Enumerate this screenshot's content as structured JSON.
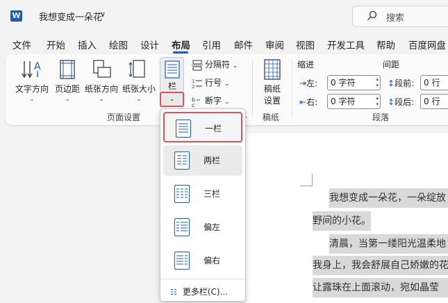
{
  "app": {
    "logo": "W",
    "doc_title": "我想变成一朵花",
    "title_chevron": "∨",
    "search_placeholder": "搜索"
  },
  "tabs": [
    "文件",
    "开始",
    "插入",
    "绘图",
    "设计",
    "布局",
    "引用",
    "邮件",
    "审阅",
    "视图",
    "开发工具",
    "帮助",
    "百度网盘"
  ],
  "active_tab": "布局",
  "ribbon": {
    "text_direction": "文字方向",
    "margins": "页边距",
    "orientation": "纸张方向",
    "size": "纸张大小",
    "columns": "栏",
    "breaks": "分隔符",
    "line_numbers": "行号",
    "hyphenation": "断字",
    "page_setup_group": "页面设置",
    "manuscript_line1": "稿纸",
    "manuscript_line2": "设置",
    "manuscript_group": "稿纸",
    "indent_title": "缩进",
    "spacing_title": "间距",
    "left_label": "左:",
    "right_label": "右:",
    "left_value": "0 字符",
    "right_value": "0 字符",
    "before_label": "段前:",
    "after_label": "段后:",
    "before_value": "0 行",
    "after_value": "0 行",
    "paragraph_group": "段落"
  },
  "dropdown": {
    "items": [
      "一栏",
      "两栏",
      "三栏",
      "偏左",
      "偏右"
    ],
    "more": "更多栏(C)..."
  },
  "document": {
    "lines": [
      "我想变成一朵花，一朵绽放",
      "野间的小花。",
      "清晨，当第一缕阳光温柔地",
      "我身上，我会舒展自己娇嫩的花",
      "让露珠在上面滚动，宛如晶莹"
    ]
  },
  "colors": {
    "accent": "#185abd",
    "highlight": "#e0505a"
  }
}
